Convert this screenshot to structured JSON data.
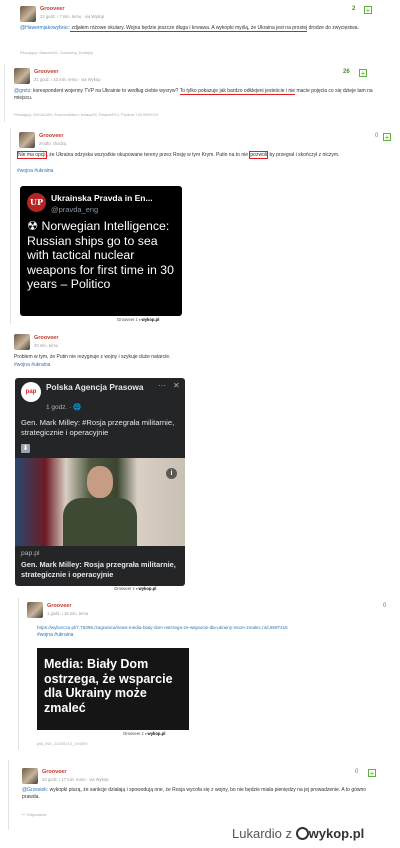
{
  "posts": [
    {
      "author": "Grooveer",
      "meta": "22 godz. i 7 min. temu · via Wykop",
      "votes": "2",
      "mention": "@Hawermjakowybrac:",
      "text_pre": " zdjałem różowe okulary. ",
      "text_hl": "Wojna będzie jeszcze długa i krwawa. A wykopki myślą, że Ukraina jest na prostej",
      "text_post": " drodze do zwycięstwa.",
      "footer": "Plusujący: Marcelo01, Dzwodny_Kmiejny"
    },
    {
      "author": "Grooveer",
      "meta": "21 godz. i 10 min. temu · via Wykop",
      "votes": "26",
      "mention": "@gretz:",
      "text_pre": " korespondent wojenny TVP na Ukrainie to według ciebie wysryw? ",
      "text_hl": "To tylko pokazuje jak bardzo odklejeni jesteście i nie",
      "text_post": " macie pojęcia co się dzieje tam na miejscu.",
      "footer": "Plusujący: MrCALVIN, Econcroklbon, bxiazy25, ReaperPL1, Pudma +35 INNYCH"
    },
    {
      "author": "Grooveer",
      "meta": "źródło: chodzą",
      "votes": "0",
      "text_hl1": "Nie ma opcji",
      "text_mid": ", że Ukraina odzyska wszystkie okupowane tereny przez Rosję w tym Krym. Putin na to nie ",
      "text_hl2": "pozwoli",
      "text_post": " by przegrał i skończył z niczym.",
      "tags": "#wojna #ukraina",
      "tweet": {
        "name": "Ukrainska Pravda in En...",
        "handle": "@pravda_eng",
        "logo": "UP",
        "body": "☢ Norwegian Intelligence: Russian ships go to sea with tactical nuclear weapons for first time in 30 years – Politico"
      },
      "watermark_user": "Grooveer",
      "watermark_z": "z",
      "watermark_site": "wykop.pl"
    },
    {
      "author": "Grooveer",
      "meta": "20 min. temu",
      "text": "Problem w tym, że Putin nie rezygnuje z wojny i szykuje duże natarcie.",
      "tags": "#wojna #ukraina",
      "card": {
        "org": "Polska Agencja Prasowa",
        "logo": "pap",
        "time": "1 godz. · 🌐",
        "headline": "Gen. Mark Milley: #Rosja przegrała militarnie, strategicznie i operacyjnie",
        "info": "i",
        "domain": "pap.pl",
        "caption": "Gen. Mark Milley: Rosja przegrała militarnie, strategicznie i operacyjnie",
        "close": "✕",
        "more": "···"
      },
      "watermark_user": "Grooveer",
      "watermark_z": "z",
      "watermark_site": "wykop.pl"
    },
    {
      "author": "Grooveer",
      "meta": "1 godz. i 15 min. temu",
      "votes": "0",
      "link": "https://wyborcza.pl/7,75399,/zagranica/news-media-bialy-dom-ostrzega-ze-wsparcie-dla-ukrainy-moze-zmalec,nId,6597415",
      "tags": "#wojna #ukraina",
      "banner": "Media: Biały Dom ostrzega, że wsparcie dla Ukrainy może zmaleć",
      "filename": "plik_INS_20230214_194009",
      "watermark_user": "Grooveer",
      "watermark_z": "z",
      "watermark_site": "wykop.pl"
    },
    {
      "author": "Grooveer",
      "meta": "22 godz. i 17 min. temu · via Wykop",
      "votes": "0",
      "mention": "@Grzesiek:",
      "text": " wykopki piszą, że sankcje działają i spowodują one, że Rosja wycofa się z wojny, bo nie będzie miała pieniędzy na jej prowadzenie. A to gówno prawda.",
      "footer": "Odpowiedz"
    }
  ],
  "bottom_watermark": {
    "user": "Lukardio",
    "z": "z",
    "site": "wykop.pl"
  },
  "colors": {
    "author": "#c0392b",
    "link": "#2f74b5",
    "plus": "#62b13a",
    "highlight": "#e02020"
  }
}
